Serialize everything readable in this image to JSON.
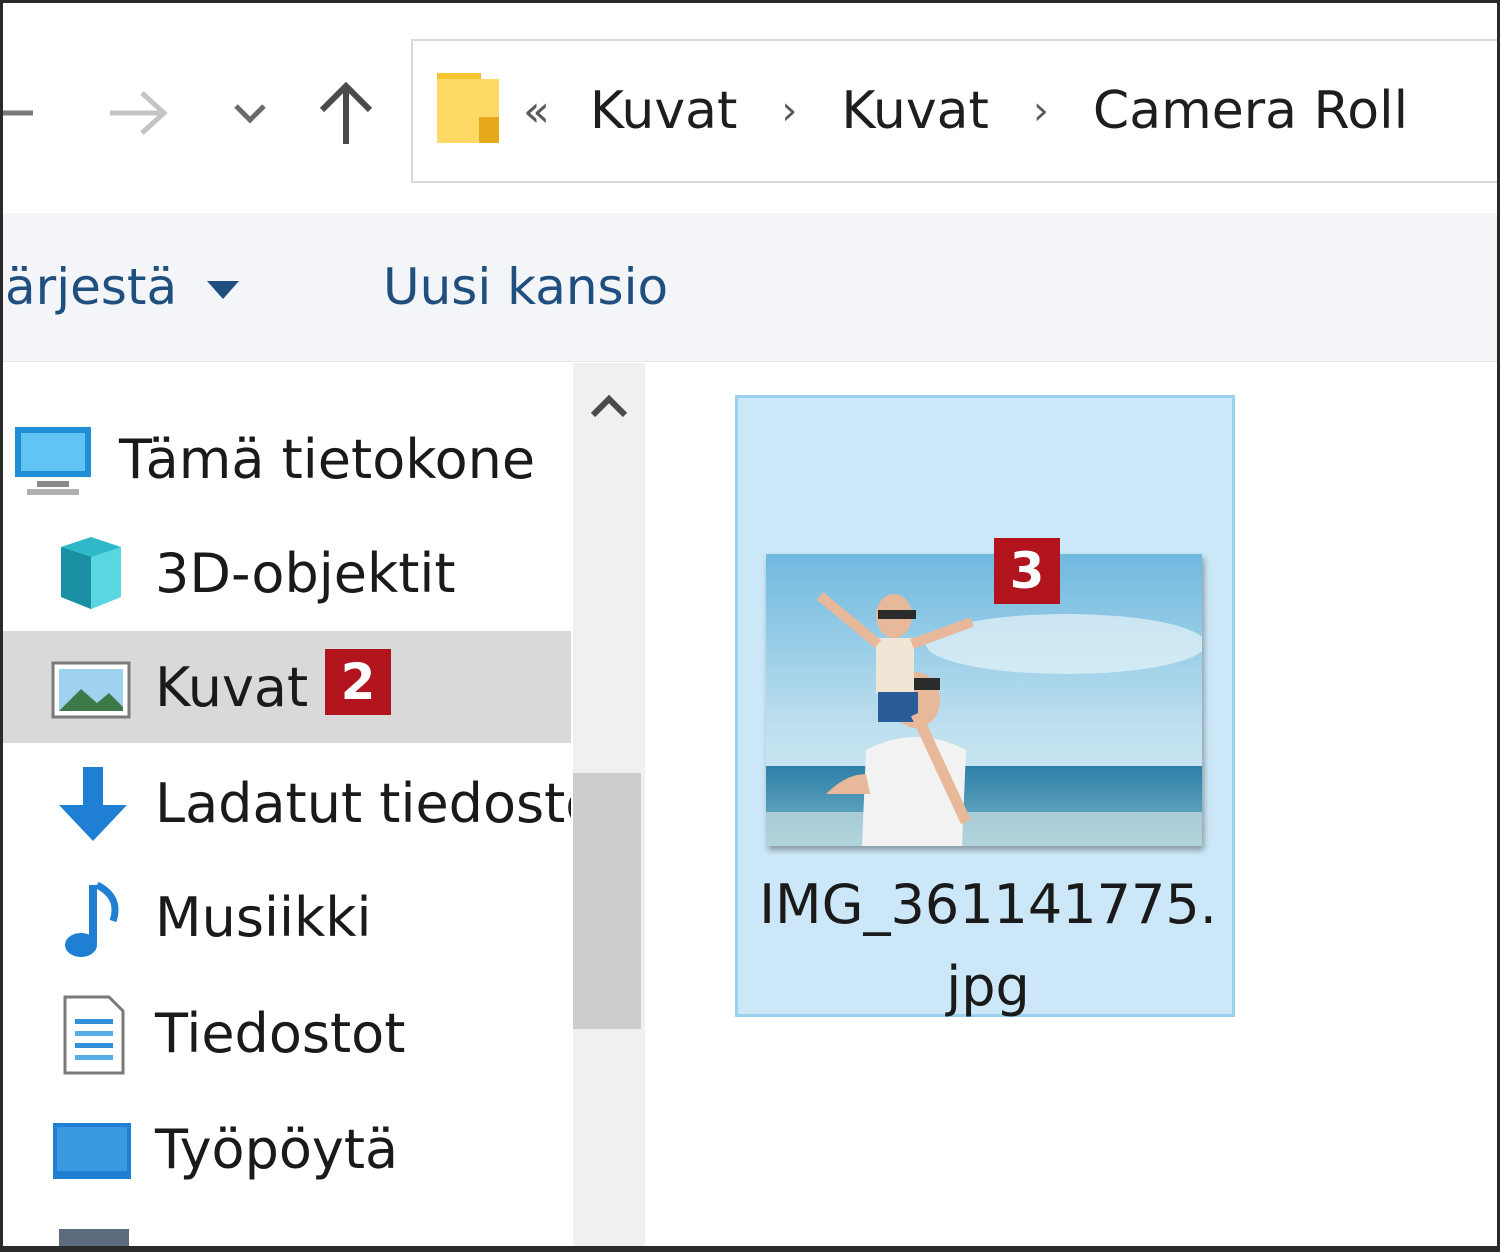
{
  "breadcrumb": {
    "overflow": "«",
    "items": [
      "Kuvat",
      "Kuvat",
      "Camera Roll"
    ],
    "separator": "›"
  },
  "commandbar": {
    "sort_label": "ärjestä",
    "new_folder_label": "Uusi kansio"
  },
  "navpane": {
    "items": [
      {
        "label": "Tämä tietokone",
        "icon": "computer-icon"
      },
      {
        "label": "3D-objektit",
        "icon": "3d-objects-icon"
      },
      {
        "label": "Kuvat",
        "icon": "pictures-icon",
        "selected": true
      },
      {
        "label": "Ladatut tiedosto",
        "icon": "downloads-icon"
      },
      {
        "label": "Musiikki",
        "icon": "music-icon"
      },
      {
        "label": "Tiedostot",
        "icon": "documents-icon"
      },
      {
        "label": "Työpöytä",
        "icon": "desktop-icon"
      }
    ]
  },
  "annotations": {
    "badge_2": "2",
    "badge_3": "3"
  },
  "files": [
    {
      "name": "IMG_361141775.jpg",
      "selected": true
    }
  ],
  "colors": {
    "selection_bg": "#cce8f8",
    "selection_border": "#99d1ef",
    "nav_selected_bg": "#d9d9d9",
    "badge_red": "#b1141d",
    "command_text": "#1e4f7e"
  }
}
